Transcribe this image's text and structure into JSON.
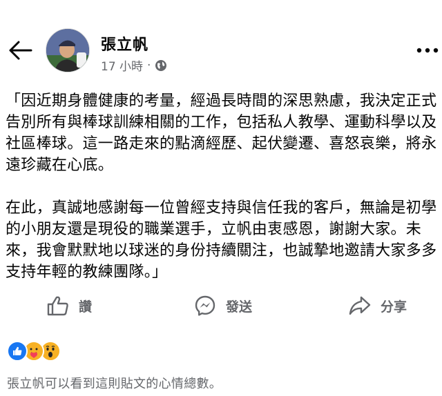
{
  "post": {
    "author": "張立帆",
    "time": "17 小時",
    "separator": "·",
    "paragraphs": [
      "「因近期身體健康的考量，經過長時間的深思熟慮，我決定正式告別所有與棒球訓練相關的工作，包括私人教學、運動科學以及社區棒球。這一路走來的點滴經歷、起伏變遷、喜怒哀樂，將永遠珍藏在心底。",
      "在此，真誠地感謝每一位曾經支持與信任我的客戶，無論是初學的小朋友還是現役的職業選手，立帆由衷感恩，謝謝大家。未來，我會默默地以球迷的身份持續關注，也誠摯地邀請大家多多支持年輕的教練團隊。」"
    ]
  },
  "actions": {
    "like": "讚",
    "comment": "發送",
    "share": "分享"
  },
  "reactions": [
    "like",
    "care",
    "wow"
  ],
  "reaction_note": "張立帆可以看到這則貼文的心情總數。",
  "icons": {
    "back": "back-arrow-icon",
    "more": "more-options-icon",
    "privacy": "globe-icon"
  },
  "colors": {
    "text": "#050505",
    "secondary": "#65676b",
    "like_blue": "#1877f2",
    "reaction_yellow": "#f7b125"
  }
}
